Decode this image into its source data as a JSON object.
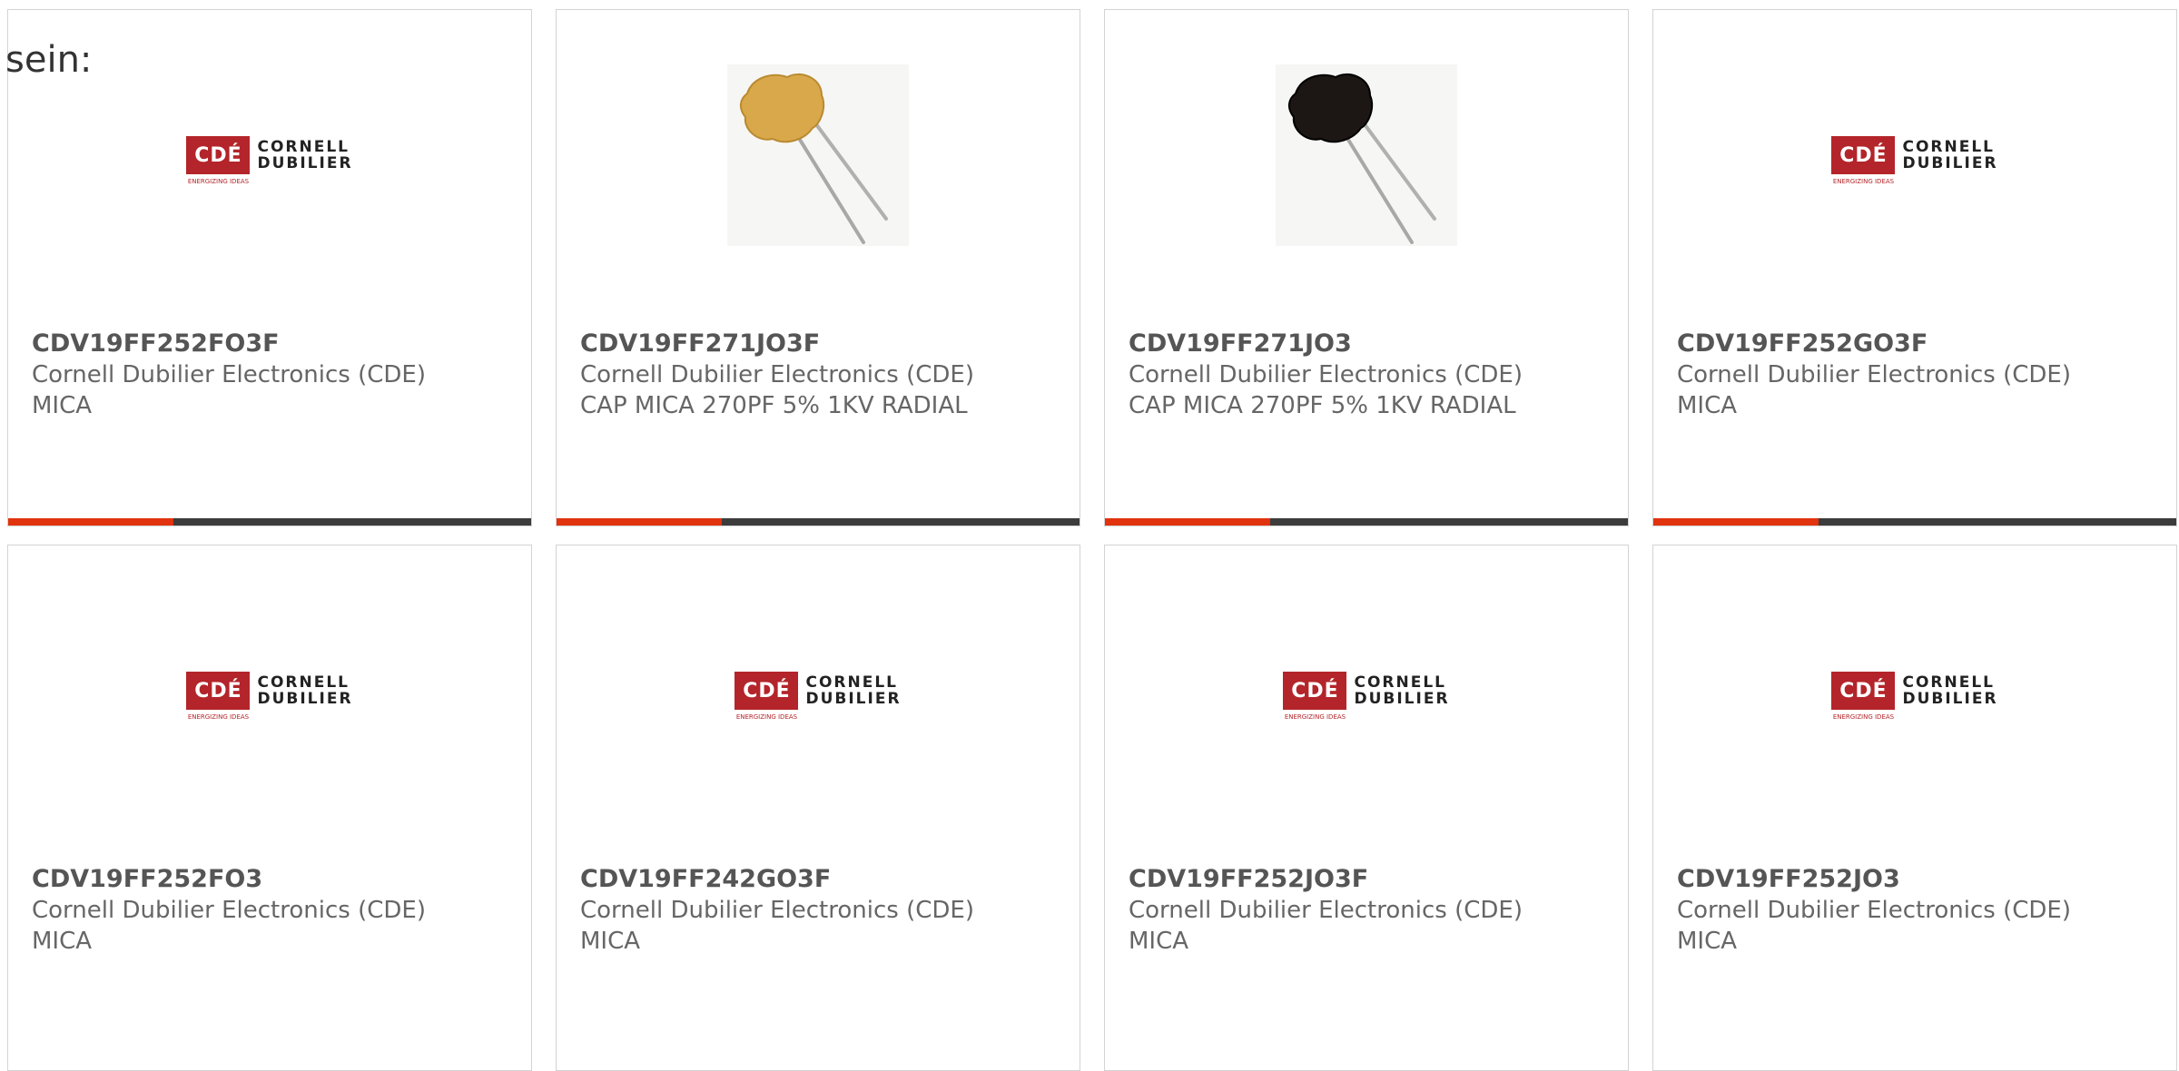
{
  "intro_text": "sein:",
  "logo": {
    "mark": "CDÉ",
    "word1": "CORNELL",
    "word2": "DUBILIER",
    "tagline": "ENERGIZING IDEAS"
  },
  "colors": {
    "accent": "#e0330e",
    "bar": "#3c3c3c",
    "logo_red": "#b3252a"
  },
  "products": [
    {
      "part": "CDV19FF252FO3F",
      "manufacturer": "Cornell Dubilier Electronics (CDE)",
      "description": "MICA",
      "image": "logo"
    },
    {
      "part": "CDV19FF271JO3F",
      "manufacturer": "Cornell Dubilier Electronics (CDE)",
      "description": "CAP MICA 270PF 5% 1KV RADIAL",
      "image": "capacitor-tan"
    },
    {
      "part": "CDV19FF271JO3",
      "manufacturer": "Cornell Dubilier Electronics (CDE)",
      "description": "CAP MICA 270PF 5% 1KV RADIAL",
      "image": "capacitor-dark"
    },
    {
      "part": "CDV19FF252GO3F",
      "manufacturer": "Cornell Dubilier Electronics (CDE)",
      "description": "MICA",
      "image": "logo"
    },
    {
      "part": "CDV19FF252FO3",
      "manufacturer": "Cornell Dubilier Electronics (CDE)",
      "description": "MICA",
      "image": "logo"
    },
    {
      "part": "CDV19FF242GO3F",
      "manufacturer": "Cornell Dubilier Electronics (CDE)",
      "description": "MICA",
      "image": "logo"
    },
    {
      "part": "CDV19FF252JO3F",
      "manufacturer": "Cornell Dubilier Electronics (CDE)",
      "description": "MICA",
      "image": "logo"
    },
    {
      "part": "CDV19FF252JO3",
      "manufacturer": "Cornell Dubilier Electronics (CDE)",
      "description": "MICA",
      "image": "logo"
    }
  ]
}
